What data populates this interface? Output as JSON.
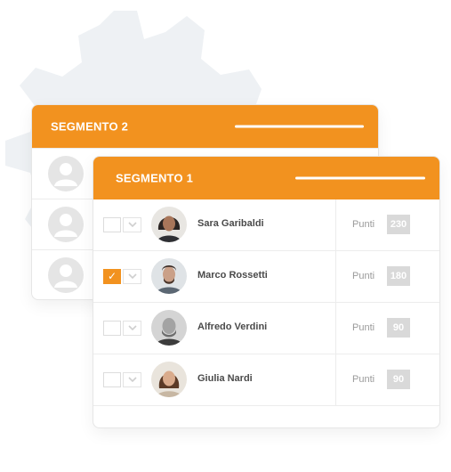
{
  "colors": {
    "accent": "#f2921f",
    "gear": "#eef1f4",
    "score_bg": "#d9d9d9",
    "avatar_placeholder": "#e5e5e5"
  },
  "segment2": {
    "title": "SEGMENTO 2",
    "rows": 3
  },
  "segment1": {
    "title": "SEGMENTO 1",
    "rows": [
      {
        "name": "Sara Garibaldi",
        "points_label": "Punti",
        "points": "230",
        "checked": false
      },
      {
        "name": "Marco Rossetti",
        "points_label": "Punti",
        "points": "180",
        "checked": true
      },
      {
        "name": "Alfredo Verdini",
        "points_label": "Punti",
        "points": "90",
        "checked": false
      },
      {
        "name": "Giulia Nardi",
        "points_label": "Punti",
        "points": "90",
        "checked": false
      }
    ]
  }
}
